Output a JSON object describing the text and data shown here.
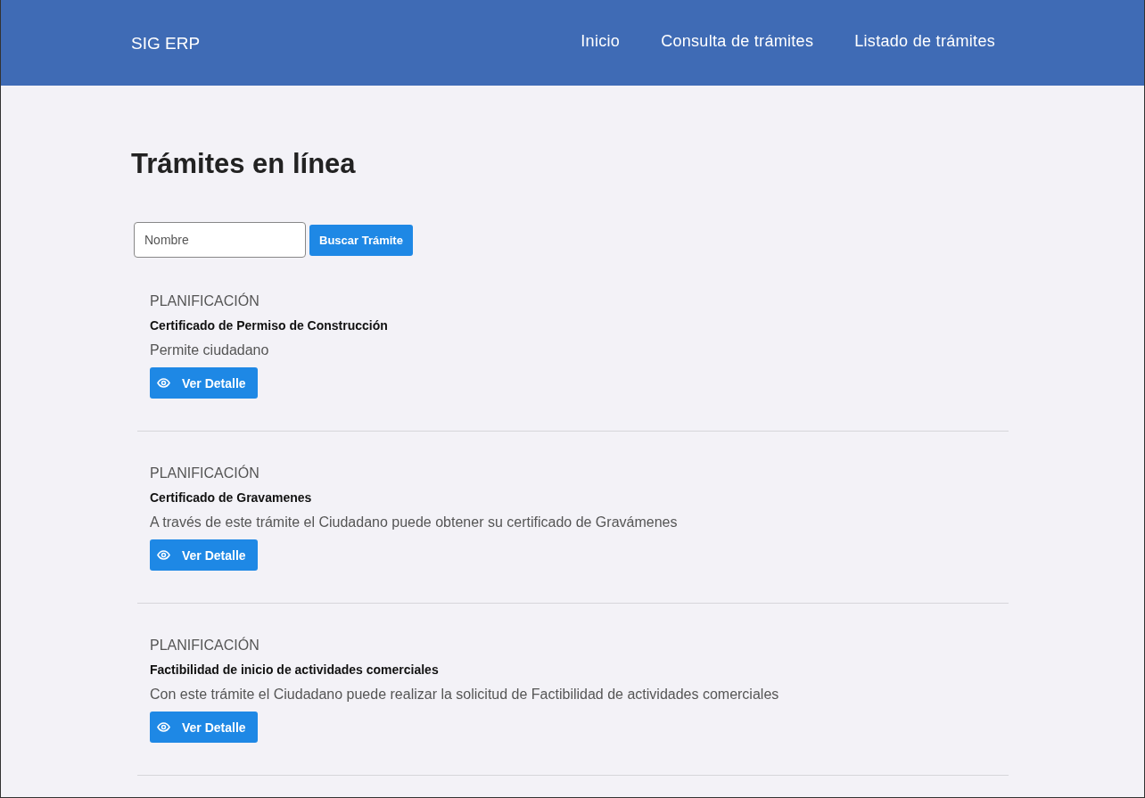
{
  "brand": "SIG ERP",
  "nav": [
    {
      "label": "Inicio"
    },
    {
      "label": "Consulta de trámites"
    },
    {
      "label": "Listado de trámites"
    }
  ],
  "heading": "Trámites en línea",
  "search": {
    "placeholder": "Nombre",
    "button": "Buscar Trámite"
  },
  "procedures": [
    {
      "category": "PLANIFICACIÓN",
      "title": "Certificado de Permiso de Construcción",
      "description": "Permite ciudadano",
      "button": "Ver Detalle"
    },
    {
      "category": "PLANIFICACIÓN",
      "title": "Certificado de Gravamenes",
      "description": "A través de este trámite el Ciudadano puede obtener su certificado de Gravámenes",
      "button": "Ver Detalle"
    },
    {
      "category": "PLANIFICACIÓN",
      "title": "Factibilidad de inicio de actividades comerciales",
      "description": "Con este trámite el Ciudadano puede realizar la solicitud de Factibilidad de actividades comerciales",
      "button": "Ver Detalle"
    }
  ]
}
